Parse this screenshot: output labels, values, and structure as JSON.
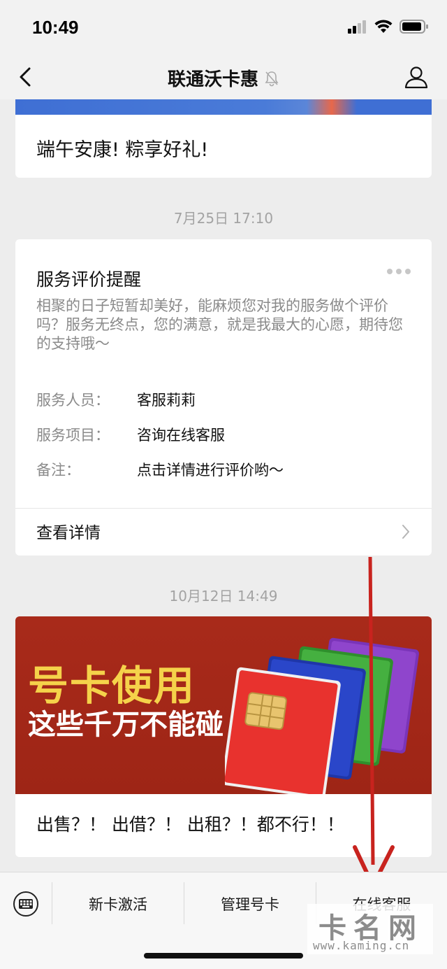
{
  "status_bar": {
    "time": "10:49"
  },
  "nav": {
    "title": "联通沃卡惠"
  },
  "messages": {
    "card1": {
      "title": "端午安康! 粽享好礼!"
    },
    "timestamp1": "7月25日 17:10",
    "card2": {
      "title": "服务评价提醒",
      "description": "相聚的日子短暂却美好，能麻烦您对我的服务做个评价吗？服务无终点，您的满意，就是我最大的心愿，期待您的支持哦～",
      "rows": [
        {
          "key": "服务人员：",
          "value": "客服莉莉"
        },
        {
          "key": "服务项目：",
          "value": "咨询在线客服"
        },
        {
          "key": "备注：",
          "value": "点击详情进行评价哟～"
        }
      ],
      "detail_label": "查看详情"
    },
    "timestamp2": "10月12日 14:49",
    "card3": {
      "banner_line1": "号卡使用",
      "banner_line2": "这些千万不能碰",
      "caption": "出售？！ 出借？！ 出租？！都不行！！"
    }
  },
  "menu": {
    "items": [
      {
        "label": "新卡激活"
      },
      {
        "label": "管理号卡"
      },
      {
        "label": "在线客服"
      }
    ]
  },
  "watermark": {
    "brand": "卡名网",
    "domain": "www.kaming.cn"
  },
  "colors": {
    "banner_red": "#a82a1a",
    "banner_yellow": "#f5d24a",
    "arrow_red": "#c8231e",
    "sim_colors": [
      "#e8322e",
      "#2a46c9",
      "#3fa83c",
      "#7a34b8"
    ]
  }
}
